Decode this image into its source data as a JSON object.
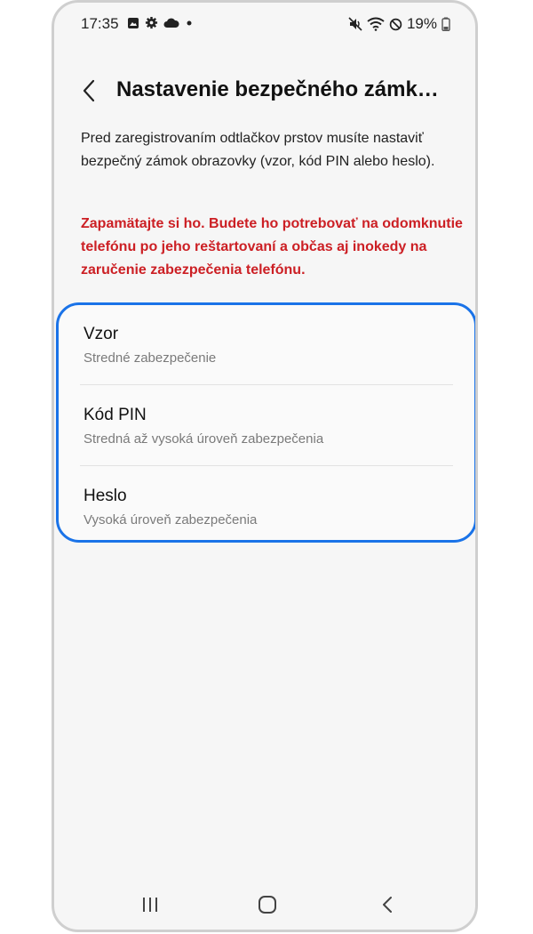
{
  "status_bar": {
    "time": "17:35",
    "battery": "19%",
    "left_icons": [
      "gallery-icon",
      "gear-icon",
      "cloud-icon",
      "dot-icon"
    ],
    "right_icons": [
      "mute-vibrate-icon",
      "wifi-icon",
      "do-not-disturb-icon",
      "battery-icon"
    ]
  },
  "header": {
    "title": "Nastavenie bezpečného zámk…",
    "back_icon": "chevron-left-icon"
  },
  "description": "Pred zaregistrovaním odtlačkov prstov musíte nastaviť bezpečný zámok obrazovky (vzor, kód PIN alebo heslo).",
  "warning": "Zapamätajte si ho. Budete ho potrebovať na odomknutie telefónu po jeho reštartovaní a občas aj inokedy na zaručenie zabezpečenia telefónu.",
  "options": [
    {
      "title": "Vzor",
      "subtitle": "Stredné zabezpečenie"
    },
    {
      "title": "Kód PIN",
      "subtitle": "Stredná až vysoká úroveň zabezpečenia"
    },
    {
      "title": "Heslo",
      "subtitle": "Vysoká úroveň zabezpečenia"
    }
  ],
  "nav_bar": {
    "icons": [
      "recent-apps-icon",
      "home-icon",
      "back-icon"
    ]
  },
  "colors": {
    "warning": "#cc1f24",
    "highlight_border": "#1a73e8",
    "background": "#f6f6f6"
  }
}
